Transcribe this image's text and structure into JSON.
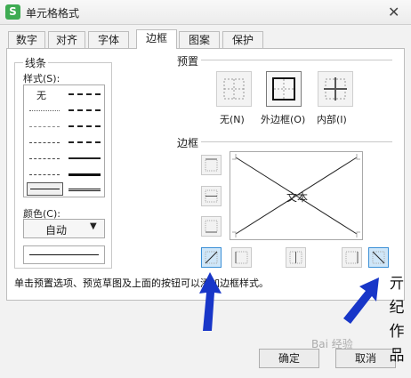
{
  "window": {
    "app_icon_letter": "S",
    "title": "单元格格式",
    "close_glyph": "✕"
  },
  "tabs": [
    {
      "label": "数字",
      "active": false
    },
    {
      "label": "对齐",
      "active": false
    },
    {
      "label": "字体",
      "active": false
    },
    {
      "label": "边框",
      "active": true
    },
    {
      "label": "图案",
      "active": false
    },
    {
      "label": "保护",
      "active": false
    }
  ],
  "line_group": {
    "title": "线条",
    "style_label": "样式(S):",
    "none_label": "无",
    "color_label": "颜色(C):",
    "color_value": "自动",
    "color_arrow": "▼"
  },
  "presets": {
    "title": "预置",
    "items": [
      {
        "label": "无(N)",
        "icon": "preset-none-icon"
      },
      {
        "label": "外边框(O)",
        "icon": "preset-outline-icon"
      },
      {
        "label": "内部(I)",
        "icon": "preset-inside-icon"
      }
    ]
  },
  "border_section": {
    "title": "边框",
    "preview_text": "文本",
    "active_diagonals": [
      "diagonal-up",
      "diagonal-down"
    ]
  },
  "hint": "单击预置选项、预览草图及上面的按钮可以添加边框样式。",
  "buttons": {
    "ok": "确定",
    "cancel": "取消"
  },
  "watermark": {
    "side_chars": [
      "亓",
      "纪",
      "作",
      "品"
    ],
    "baidu": "Bai 经验"
  },
  "annotation_colors": {
    "arrow": "#1836c8",
    "accent_select": "#3a8fd6"
  }
}
